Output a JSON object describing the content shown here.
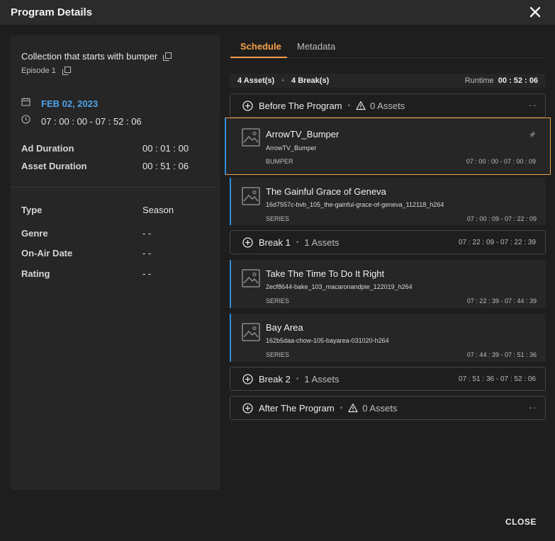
{
  "dialog": {
    "title": "Program Details",
    "close_label": "CLOSE"
  },
  "left": {
    "collection_title": "Collection that starts with bumper",
    "episode": "Episode 1",
    "date": "FEB 02, 2023",
    "time_range": "07 : 00 : 00 - 07 : 52 : 06",
    "ad_duration": {
      "label": "Ad Duration",
      "value": "00 : 01 : 00"
    },
    "asset_duration": {
      "label": "Asset Duration",
      "value": "00 : 51 : 06"
    },
    "type": {
      "label": "Type",
      "value": "Season"
    },
    "genre": {
      "label": "Genre",
      "value": "- -"
    },
    "on_air_date": {
      "label": "On-Air Date",
      "value": "- -"
    },
    "rating": {
      "label": "Rating",
      "value": "- -"
    }
  },
  "tabs": {
    "schedule": "Schedule",
    "metadata": "Metadata"
  },
  "summary": {
    "assets": "4 Asset(s)",
    "breaks": "4 Break(s)",
    "runtime_label": "Runtime",
    "runtime_value": "00 : 52 : 06"
  },
  "groups": {
    "before": {
      "name": "Before The Program",
      "count": "0 Assets",
      "time": "- -"
    },
    "break1": {
      "name": "Break 1",
      "count": "1 Assets",
      "time": "07 : 22 : 09 - 07 : 22 : 39"
    },
    "break2": {
      "name": "Break 2",
      "count": "1 Assets",
      "time": "07 : 51 : 36 - 07 : 52 : 06"
    },
    "after": {
      "name": "After The Program",
      "count": "0 Assets",
      "time": "- -"
    }
  },
  "assets": [
    {
      "name": "ArrowTV_Bumper",
      "file": "ArrowTV_Bumper",
      "type": "BUMPER",
      "time": "07 : 00 : 00 - 07 : 00 : 09"
    },
    {
      "name": "The Gainful Grace of Geneva",
      "file": "16d7557c-bvb_105_the-gainful-grace-of-geneva_112118_h264",
      "type": "SERIES",
      "time": "07 : 00 : 09 - 07 : 22 : 09"
    },
    {
      "name": "Take The Time To Do It Right",
      "file": "2ecf8644-bake_103_macaronandpie_122019_h264",
      "type": "SERIES",
      "time": "07 : 22 : 39 - 07 : 44 : 39"
    },
    {
      "name": "Bay Area",
      "file": "162b5daa-chow-105-bayarea-031020-h264",
      "type": "SERIES",
      "time": "07 : 44 : 39 - 07 : 51 : 36"
    }
  ],
  "colors": {
    "accent": "#f5a04a",
    "link": "#4fa3e8",
    "asset_bar": "#2f8cd6",
    "background": "#1e1e1e",
    "panel": "#262626"
  }
}
